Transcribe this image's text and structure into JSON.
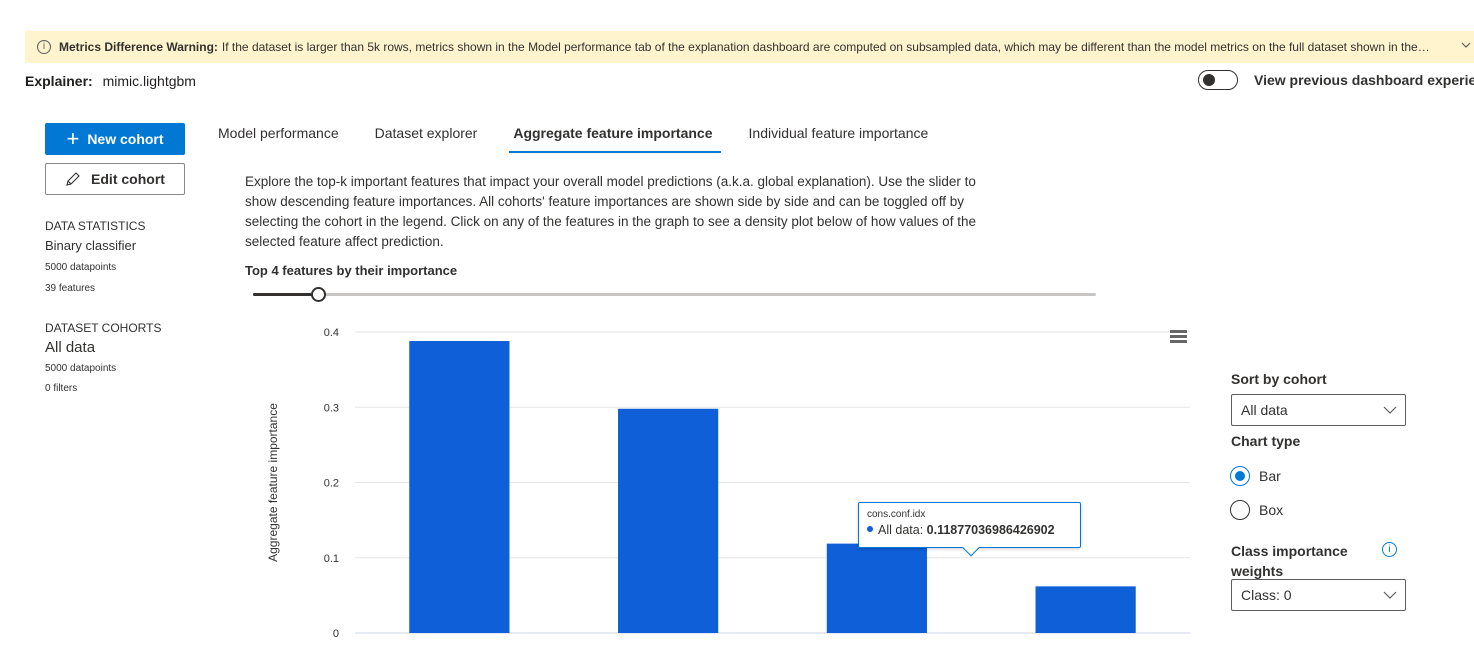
{
  "warning": {
    "title": "Metrics Difference Warning:",
    "message": "If the dataset is larger than 5k rows, metrics shown in the Model performance tab of the explanation dashboard are computed on subsampled data, which may be different than the model metrics on the full dataset shown in the M..."
  },
  "explainer": {
    "label": "Explainer:",
    "value": "mimic.lightgbm"
  },
  "toggle": {
    "label": "View previous dashboard experience",
    "on": false
  },
  "buttons": {
    "new_cohort": "New cohort",
    "edit_cohort": "Edit cohort"
  },
  "data_statistics": {
    "caption": "DATA STATISTICS",
    "classifier": "Binary classifier",
    "datapoints": "5000 datapoints",
    "features": "39 features"
  },
  "dataset_cohorts": {
    "caption": "DATASET COHORTS",
    "name": "All data",
    "datapoints": "5000 datapoints",
    "filters": "0 filters"
  },
  "tabs": [
    {
      "label": "Model performance",
      "active": false
    },
    {
      "label": "Dataset explorer",
      "active": false
    },
    {
      "label": "Aggregate feature importance",
      "active": true
    },
    {
      "label": "Individual feature importance",
      "active": false
    }
  ],
  "description": "Explore the top-k important features that impact your overall model predictions (a.k.a. global explanation). Use the slider to show descending feature importances. All cohorts' feature importances are shown side by side and can be toggled off by selecting the cohort in the legend. Click on any of the features in the graph to see a density plot below of how values of the selected feature affect prediction.",
  "topk_label": "Top 4 features by their importance",
  "slider": {
    "value": 4
  },
  "chart_data": {
    "type": "bar",
    "ylabel": "Aggregate feature importance",
    "ylim": [
      0,
      0.4
    ],
    "yticks": [
      "0",
      "0.1",
      "0.2",
      "0.3",
      "0.4"
    ],
    "grid": true,
    "bar_color": "#0f5fd8",
    "series": [
      {
        "name": "All data",
        "values": [
          0.388,
          0.298,
          0.11877036986426902,
          0.062
        ]
      }
    ]
  },
  "tooltip": {
    "feature": "cons.conf.idx",
    "series": "All data:",
    "value": "0.11877036986426902"
  },
  "right_panel": {
    "sort_label": "Sort by cohort",
    "sort_value": "All data",
    "chart_type_label": "Chart type",
    "chart_types": [
      {
        "label": "Bar",
        "checked": true
      },
      {
        "label": "Box",
        "checked": false
      }
    ],
    "class_weights_label": "Class importance weights",
    "class_value": "Class: 0"
  },
  "colors": {
    "accent": "#0078d4",
    "warning_bg": "#fff4ce",
    "bar": "#0f5fd8"
  }
}
